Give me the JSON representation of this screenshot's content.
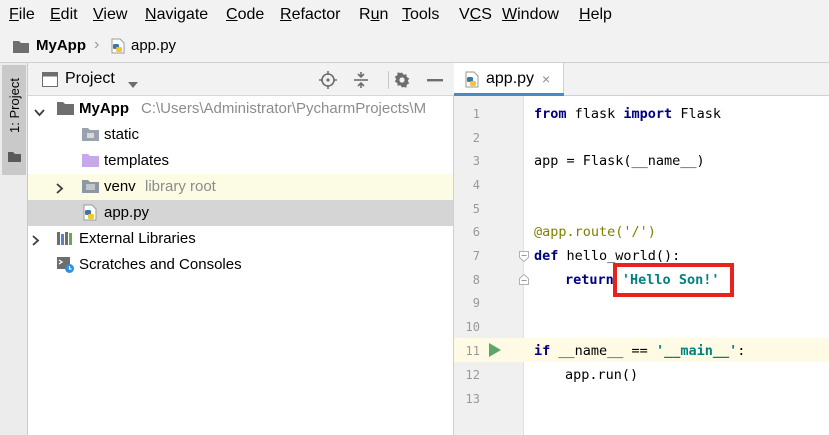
{
  "menubar": {
    "items": [
      {
        "label": "File",
        "mnemonic_index": 0
      },
      {
        "label": "Edit",
        "mnemonic_index": 0
      },
      {
        "label": "View",
        "mnemonic_index": 0
      },
      {
        "label": "Navigate",
        "mnemonic_index": 0
      },
      {
        "label": "Code",
        "mnemonic_index": 0
      },
      {
        "label": "Refactor",
        "mnemonic_index": 0
      },
      {
        "label": "Run",
        "mnemonic_index": 1
      },
      {
        "label": "Tools",
        "mnemonic_index": 0
      },
      {
        "label": "VCS",
        "mnemonic_index": 1
      },
      {
        "label": "Window",
        "mnemonic_index": 0
      },
      {
        "label": "Help",
        "mnemonic_index": 0
      }
    ]
  },
  "breadcrumb": {
    "project": "MyApp",
    "separator": "›",
    "file": "app.py"
  },
  "toolstrip": {
    "project_tab": "1: Project"
  },
  "project_panel": {
    "title": "Project",
    "tree": [
      {
        "label": "MyApp",
        "sublabel": "C:\\Users\\Administrator\\PycharmProjects\\M",
        "icon": "folder-icon",
        "bold": true,
        "expanded": true
      },
      {
        "label": "static",
        "sublabel": "",
        "icon": "folder-icon"
      },
      {
        "label": "templates",
        "sublabel": "",
        "icon": "templates-folder-icon"
      },
      {
        "label": "venv",
        "sublabel": "library root",
        "icon": "folder-icon",
        "expanded": false
      },
      {
        "label": "app.py",
        "sublabel": "",
        "icon": "python-file-icon",
        "selected": true
      },
      {
        "label": "External Libraries",
        "sublabel": "",
        "icon": "external-libraries-icon",
        "expanded": false
      },
      {
        "label": "Scratches and Consoles",
        "sublabel": "",
        "icon": "scratches-icon"
      }
    ]
  },
  "editor": {
    "tab_label": "app.py",
    "tab_close": "×",
    "line_numbers": [
      "1",
      "2",
      "3",
      "4",
      "5",
      "6",
      "7",
      "8",
      "9",
      "10",
      "11",
      "12",
      "13"
    ],
    "current_line": 11,
    "code": {
      "l1_kw1": "from",
      "l1_mod": " flask ",
      "l1_kw2": "import",
      "l1_name": " Flask",
      "l3": "app = Flask(__name__)",
      "l6_dec": "@app.route(",
      "l6_str": "'/'",
      "l6_end": ")",
      "l7_kw": "def",
      "l7_rest": " hello_world():",
      "l8_kw": "return",
      "l8_str": "'Hello Son!'",
      "l11_kw": "if",
      "l11_mid": " __name__ == ",
      "l11_str": "'__main__'",
      "l11_end": ":",
      "l12": "app.run()"
    }
  },
  "colors": {
    "keyword": "#000080",
    "string": "#008080",
    "decorator": "#808000",
    "highlight_box": "#e8231e",
    "current_line": "#fffae3",
    "selection": "#d5d5d5"
  }
}
